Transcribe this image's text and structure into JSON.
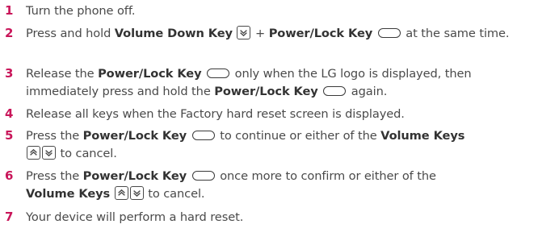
{
  "steps": [
    {
      "number": "1",
      "text": "Turn the phone off."
    },
    {
      "number": "2",
      "parts": {
        "a": "Press and hold ",
        "b": "Volume Down Key",
        "c": " + ",
        "d": "Power/Lock Key",
        "e": " at the same time."
      }
    },
    {
      "number": "3",
      "parts": {
        "a": "Release the ",
        "b": "Power/Lock Key",
        "c": " only when the LG logo is displayed, then immediately press and hold the ",
        "d": "Power/Lock Key",
        "e": " again."
      }
    },
    {
      "number": "4",
      "text": "Release all keys when the Factory hard reset screen is displayed."
    },
    {
      "number": "5",
      "parts": {
        "a": "Press the ",
        "b": "Power/Lock Key",
        "c": " to continue or either of the ",
        "d": "Volume Keys",
        "e": " to cancel."
      }
    },
    {
      "number": "6",
      "parts": {
        "a": "Press the ",
        "b": "Power/Lock Key",
        "c": " once more to confirm or either of the ",
        "d": "Volume Keys",
        "e": " to cancel."
      }
    },
    {
      "number": "7",
      "text": "Your device will perform a hard reset."
    }
  ],
  "icons": {
    "power_lock_key": "power-lock-key-icon",
    "volume_down_key": "volume-down-key-icon",
    "volume_up_key": "volume-up-key-icon"
  },
  "colors": {
    "step_number": "#c9165a",
    "body_text": "#4a4a4a"
  }
}
